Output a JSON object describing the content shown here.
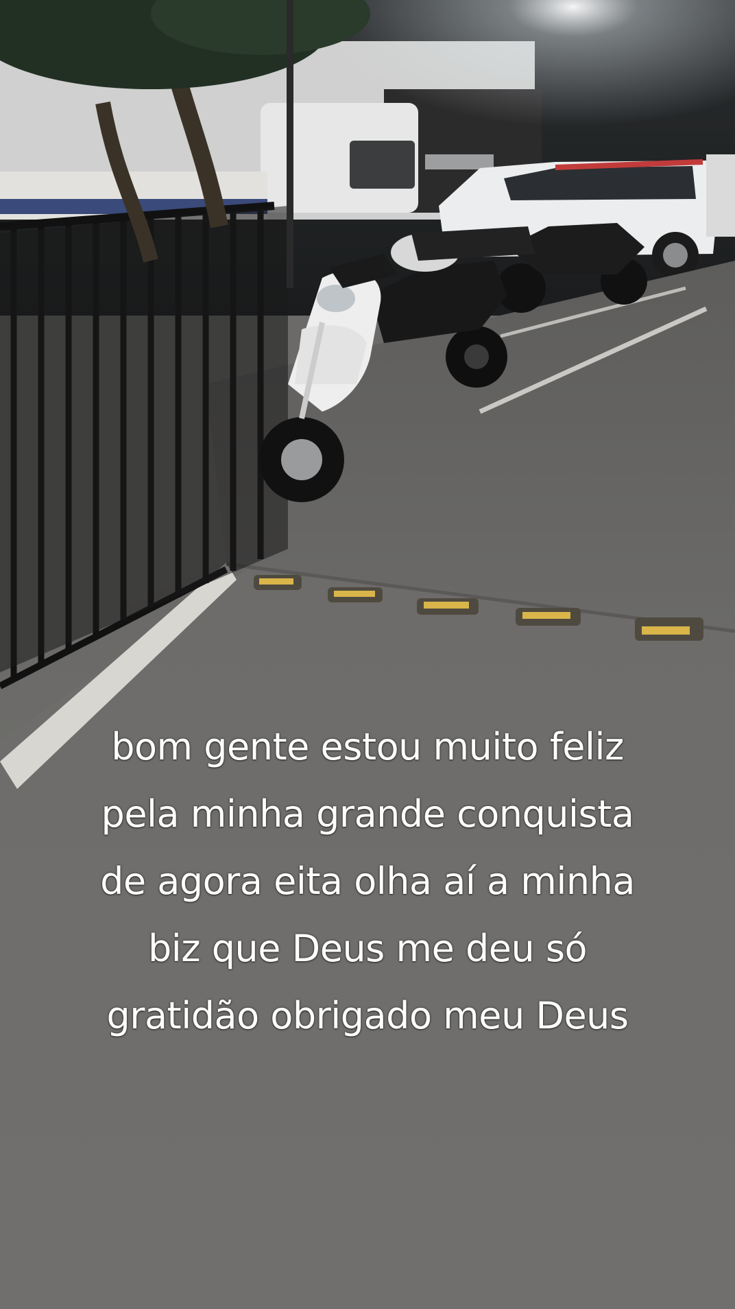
{
  "caption": {
    "lines": [
      "bom gente estou muito feliz",
      "pela minha grande conquista",
      "de agora eita olha aí a minha",
      "biz que Deus me deu só",
      "gratidão obrigado meu Deus"
    ]
  },
  "colors": {
    "pavement": "#6d6c6a",
    "night_sky": "#1d2022",
    "fence": "#141414",
    "caption_text": "#ffffff"
  },
  "icons": [
    "white-scooter",
    "black-motorcycle",
    "white-van",
    "fence",
    "tree"
  ]
}
